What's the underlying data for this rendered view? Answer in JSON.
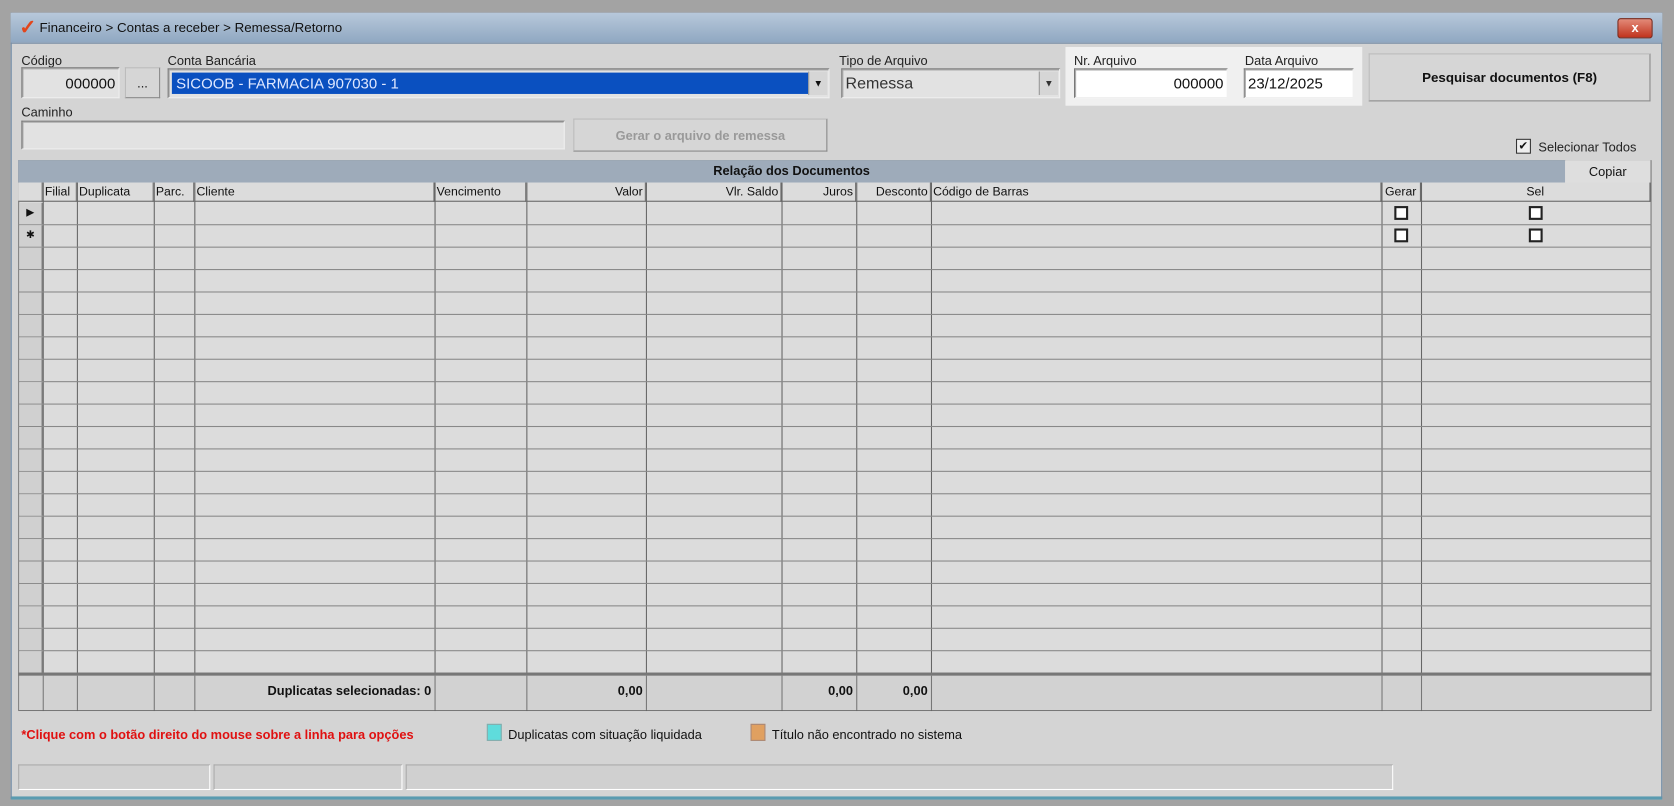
{
  "window": {
    "title": "Financeiro > Contas a receber > Remessa/Retorno",
    "close_label": "x"
  },
  "form": {
    "codigo_label": "Código",
    "codigo_value": "000000",
    "browse_label": "...",
    "conta_label": "Conta Bancária",
    "conta_value": "SICOOB - FARMACIA 907030 - 1",
    "tipo_label": "Tipo de Arquivo",
    "tipo_value": "Remessa",
    "nr_label": "Nr. Arquivo",
    "nr_value": "000000",
    "data_label": "Data Arquivo",
    "data_value": "23/12/2025",
    "pesquisar_label": "Pesquisar documentos (F8)",
    "caminho_label": "Caminho",
    "caminho_value": "",
    "gerar_label": "Gerar o arquivo de remessa",
    "selecionar_todos_label": "Selecionar Todos",
    "selecionar_todos_checked": true
  },
  "grid": {
    "title": "Relação dos Documentos",
    "copiar_label": "Copiar",
    "columns": [
      "",
      "Filial",
      "Duplicata",
      "Parc.",
      "Cliente",
      "Vencimento",
      "Valor",
      "Vlr. Saldo",
      "Juros",
      "Desconto",
      "Código de Barras",
      "Gerar",
      "Sel"
    ],
    "indicators": [
      "▶",
      "✱"
    ],
    "footer": {
      "selecionadas": "Duplicatas selecionadas: 0",
      "valor": "0,00",
      "juros": "0,00",
      "desconto": "0,00"
    }
  },
  "legend": {
    "hint": "*Clique com o botão direito do mouse sobre a linha para opções",
    "liquidada": "Duplicatas com situação liquidada",
    "liquidada_color": "#5fdcdc",
    "nao_encontrado": "Título não encontrado no sistema",
    "nao_encontrado_color": "#e0a060"
  }
}
